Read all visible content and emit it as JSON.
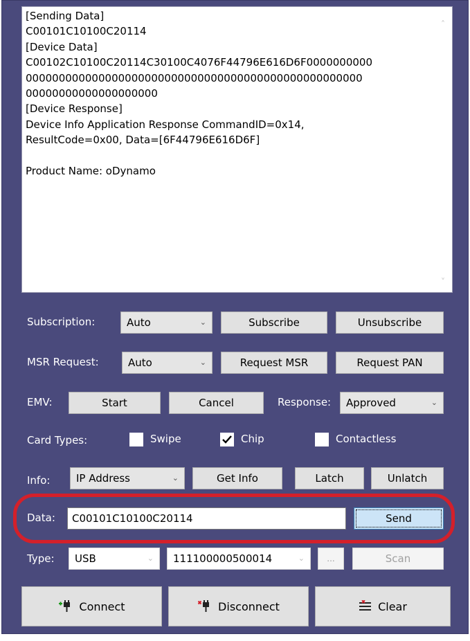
{
  "output": {
    "lines": [
      "[Sending Data]",
      "C00101C10100C20114",
      "[Device Data]",
      "C00102C10100C20114C30100C4076F44796E616D6F0000000000",
      "000000000000000000000000000000000000000000000000000",
      "00000000000000000000",
      "[Device Response]",
      "Device Info Application Response CommandID=0x14,",
      "ResultCode=0x00, Data=[6F44796E616D6F]",
      "",
      "Product Name: oDynamo"
    ]
  },
  "subscription": {
    "label": "Subscription:",
    "selected": "Auto",
    "subscribe_label": "Subscribe",
    "unsubscribe_label": "Unsubscribe"
  },
  "msr": {
    "label": "MSR Request:",
    "selected": "Auto",
    "request_msr_label": "Request MSR",
    "request_pan_label": "Request PAN"
  },
  "emv": {
    "label": "EMV:",
    "start_label": "Start",
    "cancel_label": "Cancel",
    "response_label": "Response:",
    "response_selected": "Approved"
  },
  "card_types": {
    "label": "Card Types:",
    "swipe_label": "Swipe",
    "swipe_checked": false,
    "chip_label": "Chip",
    "chip_checked": true,
    "contactless_label": "Contactless",
    "contactless_checked": false
  },
  "info": {
    "label": "Info:",
    "selected": "IP Address",
    "get_info_label": "Get Info",
    "latch_label": "Latch",
    "unlatch_label": "Unlatch"
  },
  "data": {
    "label": "Data:",
    "value": "C00101C10100C20114",
    "send_label": "Send"
  },
  "type": {
    "label": "Type:",
    "selected": "USB",
    "device_selected": "111100000500014",
    "browse_label": "...",
    "scan_label": "Scan"
  },
  "actions": {
    "connect_label": "Connect",
    "disconnect_label": "Disconnect",
    "clear_label": "Clear"
  },
  "colors": {
    "panel_bg": "#4a4a7c",
    "highlight": "#d4202a",
    "send_bg": "#cce4f7"
  }
}
